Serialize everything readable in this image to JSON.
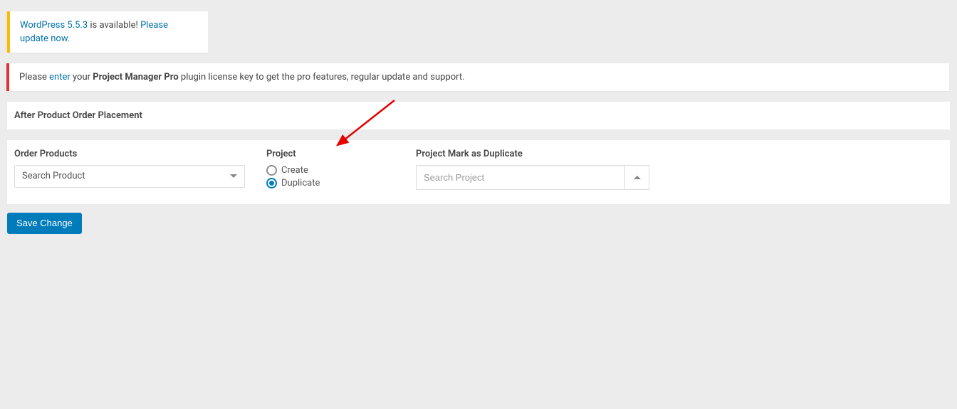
{
  "update_notice": {
    "prefix": "WordPress 5.5.3",
    "middle": " is available! ",
    "link": "Please update now."
  },
  "license_notice": {
    "prefix": "Please ",
    "link": "enter",
    "middle": " your ",
    "product": "Project Manager Pro",
    "suffix": " plugin license key to get the pro features, regular update and support."
  },
  "section_title": "After Product Order Placement",
  "order_products": {
    "label": "Order Products",
    "placeholder": "Search Product"
  },
  "project": {
    "label": "Project",
    "options": {
      "create": "Create",
      "duplicate": "Duplicate"
    },
    "selected": "duplicate"
  },
  "project_duplicate": {
    "label": "Project Mark as Duplicate",
    "placeholder": "Search Project"
  },
  "save_button": "Save Change"
}
